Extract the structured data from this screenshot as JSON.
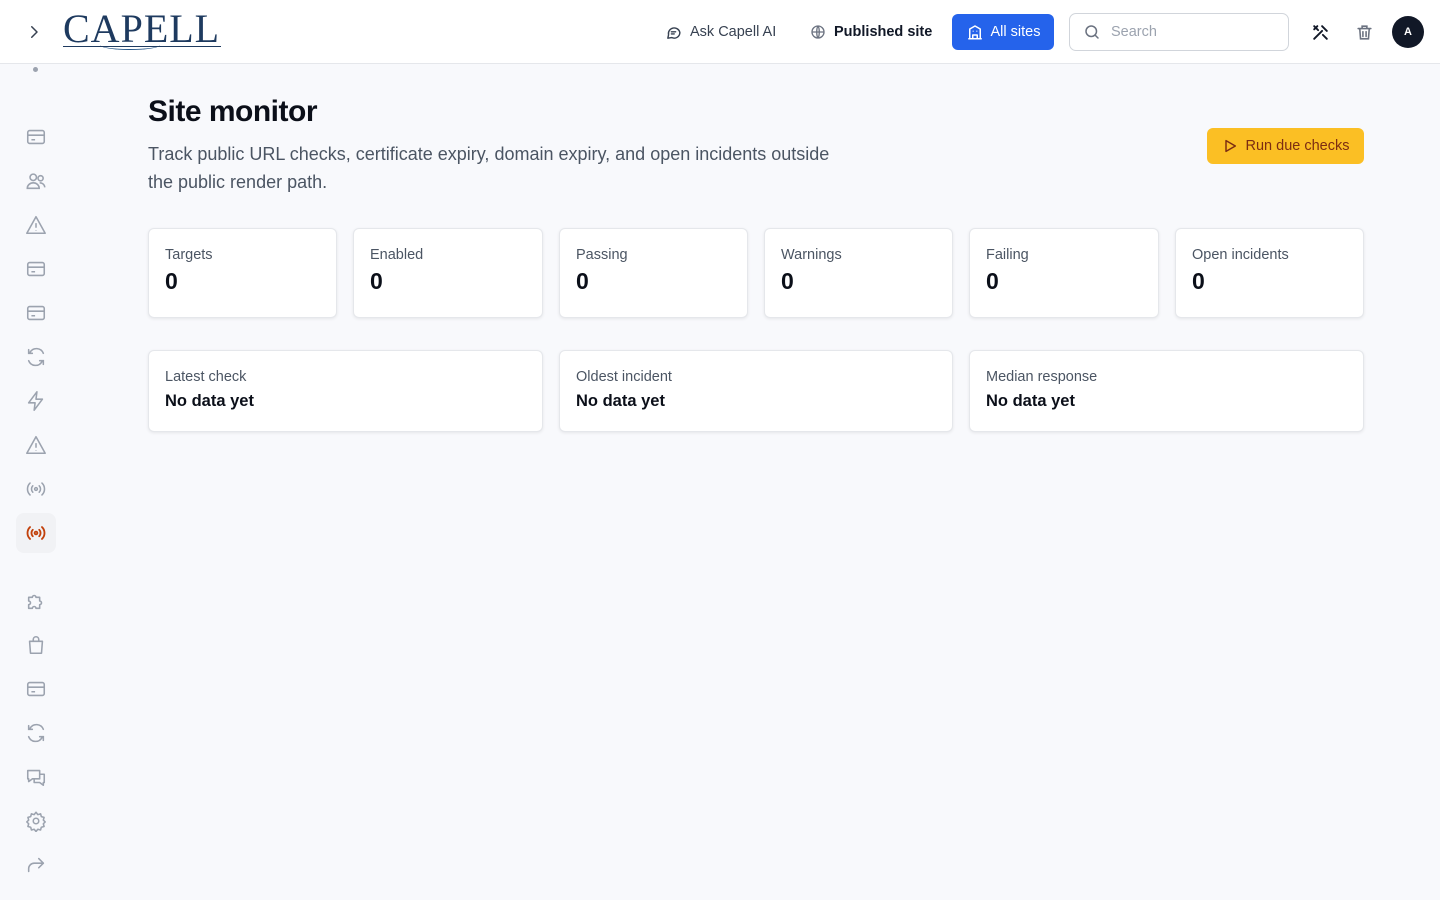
{
  "header": {
    "logo": "CAPELL",
    "ask_ai": "Ask Capell AI",
    "published_site": "Published site",
    "all_sites": "All sites",
    "search_placeholder": "Search",
    "avatar_initial": "A"
  },
  "sidebar": {
    "icons": [
      "card-icon",
      "users-icon",
      "alert-triangle-icon",
      "card-icon",
      "card-icon",
      "refresh-icon",
      "lightning-icon",
      "alert-triangle-icon",
      "broadcast-icon",
      "broadcast-icon",
      "puzzle-icon",
      "shopping-bag-icon",
      "card-icon",
      "refresh-icon",
      "chat-icon",
      "gear-icon",
      "share-icon"
    ],
    "active": "broadcast-icon"
  },
  "page": {
    "title": "Site monitor",
    "description": "Track public URL checks, certificate expiry, domain expiry, and open incidents outside the public render path.",
    "run_button": "Run due checks"
  },
  "stats": [
    {
      "label": "Targets",
      "value": "0"
    },
    {
      "label": "Enabled",
      "value": "0"
    },
    {
      "label": "Passing",
      "value": "0"
    },
    {
      "label": "Warnings",
      "value": "0"
    },
    {
      "label": "Failing",
      "value": "0"
    },
    {
      "label": "Open incidents",
      "value": "0"
    }
  ],
  "info": [
    {
      "label": "Latest check",
      "value": "No data yet"
    },
    {
      "label": "Oldest incident",
      "value": "No data yet"
    },
    {
      "label": "Median response",
      "value": "No data yet"
    }
  ],
  "colors": {
    "primary": "#2563eb",
    "accent": "#fbbf24",
    "active_icon": "#c2410c"
  }
}
